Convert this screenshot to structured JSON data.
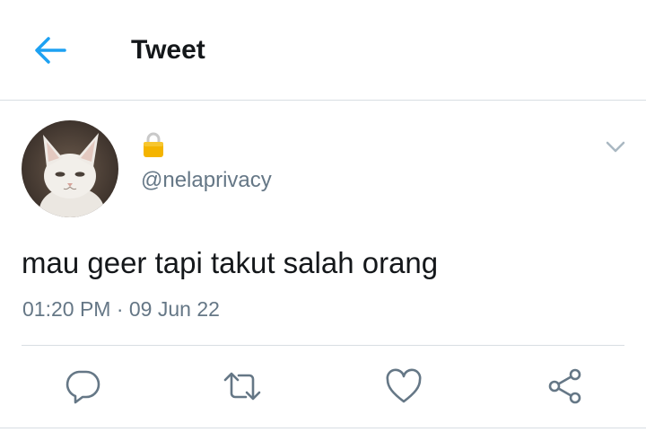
{
  "header": {
    "title": "Tweet",
    "back_icon": "arrow-left-icon"
  },
  "tweet": {
    "author": {
      "avatar_icon": "cat-avatar",
      "protected_icon": "lock-icon",
      "handle": "@nelaprivacy"
    },
    "text": "mau geer tapi takut salah orang",
    "timestamp": "01:20 PM · 09 Jun 22",
    "menu_icon": "chevron-down-icon"
  },
  "actions": [
    {
      "icon": "reply-icon"
    },
    {
      "icon": "retweet-icon"
    },
    {
      "icon": "like-icon"
    },
    {
      "icon": "share-icon"
    }
  ],
  "colors": {
    "accent": "#1da1f2",
    "text_primary": "#14171a",
    "text_secondary": "#657786",
    "divider": "#d8dee3",
    "lock": "#f4b400"
  }
}
